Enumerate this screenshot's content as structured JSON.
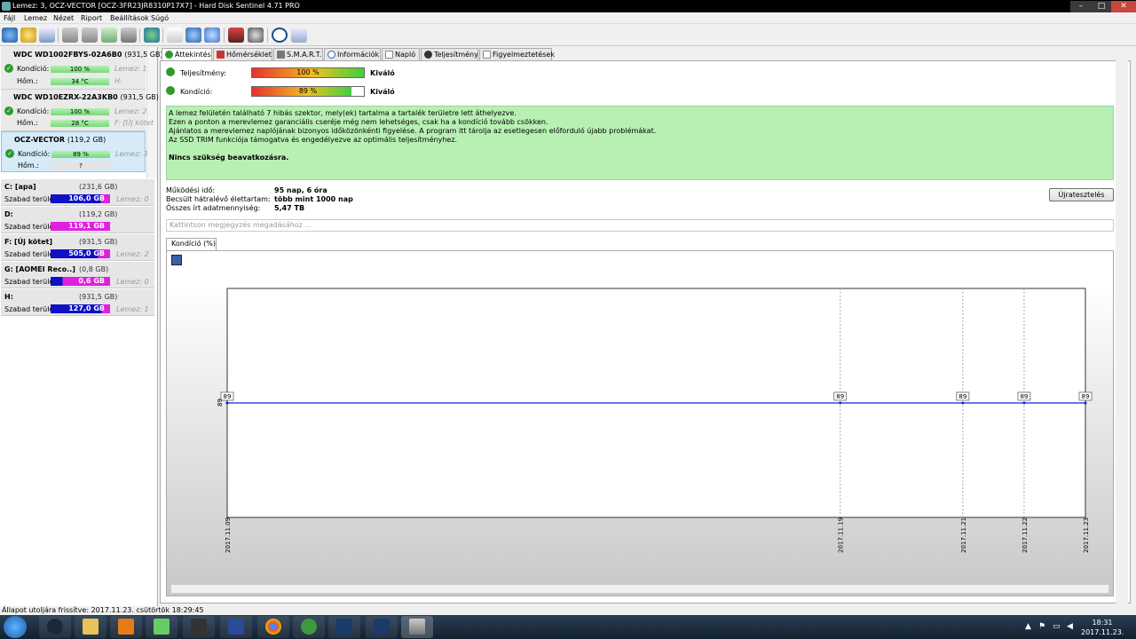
{
  "window": {
    "title": "Lemez: 3, OCZ-VECTOR [OCZ-3FR23JR8310P17X7]  -  Hard Disk Sentinel 4.71 PRO"
  },
  "menu": [
    "Fájl",
    "Lemez",
    "Nézet",
    "Riport",
    "Beállítások",
    "Súgó"
  ],
  "disks": [
    {
      "name": "WDC WD1002FBYS-02A6B0",
      "size": "(931,5 GB)",
      "condition_label": "Kondíció:",
      "condition": "100 %",
      "temp_label": "Hőm.:",
      "temp": "34 °C",
      "extra1": "Lemez: 1",
      "extra2": "H:"
    },
    {
      "name": "WDC WD10EZRX-22A3KB0",
      "size": "(931,5 GB)",
      "condition_label": "Kondíció:",
      "condition": "100 %",
      "temp_label": "Hőm.:",
      "temp": "28 °C",
      "extra1": "Lemez: 2",
      "extra2": "F: [Új kötet"
    },
    {
      "name": "OCZ-VECTOR",
      "size": "(119,2 GB)",
      "condition_label": "Kondíció:",
      "condition": "89 %",
      "temp_label": "Hőm.:",
      "temp": "?",
      "extra1": "Lemez: 3",
      "extra2": ""
    }
  ],
  "partitions": [
    {
      "name": "C: [apa]",
      "size": "(231,6 GB)",
      "free_label": "Szabad terület",
      "free": "106,0 GB",
      "disk": "Lemez: 0"
    },
    {
      "name": "D:",
      "size": "(119,2 GB)",
      "free_label": "Szabad terület",
      "free": "119,1 GB",
      "disk": ""
    },
    {
      "name": "F: [Új kötet]",
      "size": "(931,5 GB)",
      "free_label": "Szabad terület",
      "free": "505,0 GB",
      "disk": "Lemez: 2"
    },
    {
      "name": "G: [AOMEI Reco..]",
      "size": "(0,8 GB)",
      "free_label": "Szabad terület",
      "free": "0,6 GB",
      "disk": "Lemez: 0"
    },
    {
      "name": "H:",
      "size": "(931,5 GB)",
      "free_label": "Szabad terület",
      "free": "127,0 GB",
      "disk": "Lemez: 1"
    }
  ],
  "tabs": [
    "Áttekintés",
    "Hőmérséklet",
    "S.M.A.R.T.",
    "Információk",
    "Napló",
    "Teljesítmény",
    "Figyelmeztetések"
  ],
  "overview": {
    "performance_label": "Teljesítmény:",
    "performance_value": "100 %",
    "performance_rating": "Kiváló",
    "performance_pct": 100,
    "condition_label": "Kondíció:",
    "condition_value": "89 %",
    "condition_rating": "Kiváló",
    "condition_pct": 89,
    "info_lines": [
      "A lemez felületén található 7 hibás szektor, mely(ek) tartalma a tartalék területre lett áthelyezve.",
      "Ezen a ponton a merevlemez garanciális cseréje még nem lehetséges, csak ha a kondíció tovább csökken.",
      "Ajánlatos a merevlemez naplójának bizonyos időközönkénti figyelése. A program itt tárolja az esetlegesen előforduló újabb problémákat.",
      "Az SSD TRIM funkciója támogatva és engedélyezve az optimális teljesítményhez."
    ],
    "info_note": "Nincs szükség beavatkozásra.",
    "uptime_label": "Működési idő:",
    "uptime_value": "95 nap, 6 óra",
    "lifetime_label": "Becsült hátralévő élettartam:",
    "lifetime_value": "több mint 1000 nap",
    "written_label": "Összes írt adatmennyiség:",
    "written_value": "5,47 TB",
    "retest_button": "Újratesztelés",
    "note_placeholder": "Kattintson megjegyzés megadásához ..."
  },
  "chart_tab": "Kondíció  (%)",
  "chart_data": {
    "type": "line",
    "x": [
      "2017.11.09",
      "2017.11.19",
      "2017.11.21",
      "2017.11.22",
      "2017.11.23"
    ],
    "series": [
      {
        "values": [
          89,
          89,
          89,
          89,
          89
        ]
      }
    ],
    "ylabel": "89",
    "grid": true
  },
  "statusbar": "Állapot utoljára frissítve: 2017.11.23. csütörtök 18:29:45",
  "taskbar": {
    "time": "18:31",
    "date": "2017.11.23."
  },
  "colors": {
    "ok_green": "#2e9a2e",
    "info_bg": "#b8f0b4",
    "free_bar_blue": "#1010c8",
    "free_bar_magenta": "#e020e0",
    "line": "#1a1ae0"
  }
}
